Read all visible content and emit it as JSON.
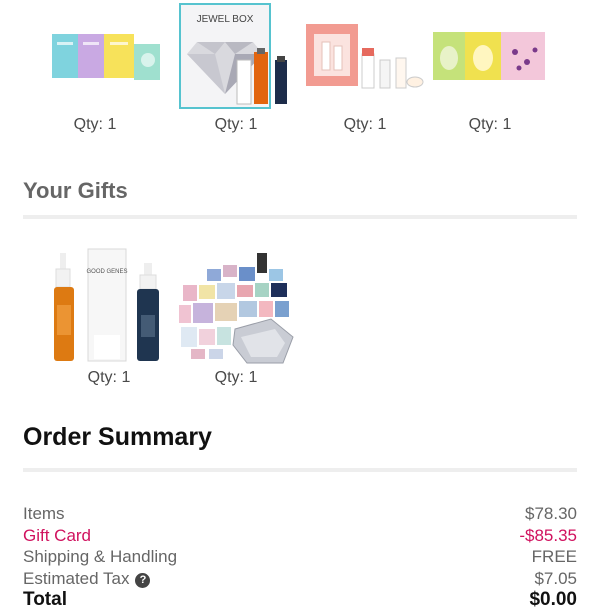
{
  "products": [
    {
      "name": "sheet-masks-set",
      "qty_label": "Qty: 1"
    },
    {
      "name": "jewel-box-set",
      "box_title": "JEWEL BOX",
      "qty_label": "Qty: 1"
    },
    {
      "name": "skincare-trial-set",
      "qty_label": "Qty: 1"
    },
    {
      "name": "gel-eye-patches-set",
      "qty_label": "Qty: 1"
    }
  ],
  "gifts": {
    "title": "Your Gifts",
    "items": [
      {
        "name": "sunday-riley-minis",
        "brand_text": "GOOD GENES",
        "qty_label": "Qty: 1"
      },
      {
        "name": "deluxe-sample-bundle",
        "qty_label": "Qty: 1"
      }
    ]
  },
  "order_summary": {
    "title": "Order Summary",
    "rows": [
      {
        "label": "Items",
        "value": "$78.30"
      },
      {
        "label": "Gift Card",
        "value": "-$85.35"
      },
      {
        "label": "Shipping & Handling",
        "value": "FREE"
      },
      {
        "label": "Estimated Tax",
        "value": "$7.05",
        "help_icon": "question-circle-icon"
      },
      {
        "label": "Total",
        "value": "$0.00"
      }
    ]
  },
  "colors": {
    "gift_card": "#d0115e",
    "divider": "#eeeeee",
    "muted_text": "#666666"
  }
}
